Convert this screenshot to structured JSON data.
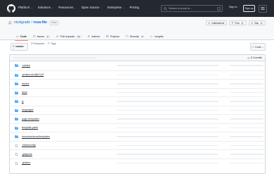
{
  "header": {
    "nav": [
      {
        "label": "Platform"
      },
      {
        "label": "Solutions"
      },
      {
        "label": "Resources"
      },
      {
        "label": "Open Source"
      },
      {
        "label": "Enterprise"
      },
      {
        "label": "Pricing"
      }
    ],
    "search_placeholder": "Search or jump to...",
    "search_shortcut": "/",
    "signin": "Sign in",
    "signup": "Sign up"
  },
  "repo": {
    "owner": "nicolgrade",
    "separator": "/",
    "name": "rosa-lite",
    "visibility": "Public",
    "actions": {
      "notifications": "Notifications",
      "fork_label": "Fork",
      "fork_count": "0",
      "star_label": "Star",
      "star_count": "0"
    },
    "tabs": [
      {
        "label": "Code",
        "count": "",
        "icon": "code-icon"
      },
      {
        "label": "Issues",
        "count": "2",
        "icon": "issue-icon"
      },
      {
        "label": "Pull requests",
        "count": "14",
        "icon": "pull-request-icon"
      },
      {
        "label": "Actions",
        "count": "",
        "icon": "play-icon"
      },
      {
        "label": "Projects",
        "count": "",
        "icon": "table-icon"
      },
      {
        "label": "Security",
        "count": "0",
        "icon": "shield-icon"
      },
      {
        "label": "Insights",
        "count": "",
        "icon": "graph-icon"
      }
    ]
  },
  "branchbar": {
    "branch": "master",
    "branches": "Branches",
    "tags": "Tags",
    "code_button": "Code"
  },
  "commits": {
    "count": "1",
    "label": "Commits"
  },
  "files": [
    {
      "name": ".circleci",
      "type": "folder"
    },
    {
      "name": ".jenkins.d/ci@b7c2f",
      "type": "folder-link"
    },
    {
      "name": "assets",
      "type": "folder"
    },
    {
      "name": "docs",
      "type": "folder"
    },
    {
      "name": "js",
      "type": "folder"
    },
    {
      "name": "languages",
      "type": "folder"
    },
    {
      "name": "page-templates",
      "type": "folder"
    },
    {
      "name": "template-parts",
      "type": "folder"
    },
    {
      "name": "woocommerce/templates",
      "type": "folder"
    },
    {
      "name": ".editorconfig",
      "type": "file"
    },
    {
      "name": ".gitignore",
      "type": "file"
    },
    {
      "name": ".jshintrc",
      "type": "file"
    }
  ],
  "colors": {
    "header_bg": "#24292f",
    "link": "#0969da",
    "folder": "#54aeff",
    "active_tab": "#fd8c73"
  }
}
